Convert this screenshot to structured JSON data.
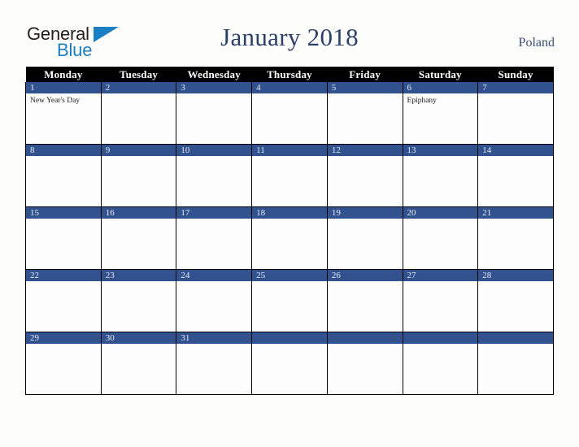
{
  "brand": {
    "name_part1": "General",
    "name_part2": "Blue",
    "triangle_icon": "triangle-icon",
    "accent_blue": "#1b7fc4"
  },
  "header": {
    "title": "January 2018",
    "region": "Poland",
    "title_color": "#2b3f69"
  },
  "calendar": {
    "month": "January",
    "year": "2018",
    "country": "Poland",
    "weekday_headers": [
      "Monday",
      "Tuesday",
      "Wednesday",
      "Thursday",
      "Friday",
      "Saturday",
      "Sunday"
    ],
    "header_bg": "#000000",
    "daybar_bg": "#31528f",
    "cell_bg": "#fdfdfd",
    "weeks": [
      {
        "days": [
          {
            "num": "1",
            "event": "New Year's Day"
          },
          {
            "num": "2",
            "event": ""
          },
          {
            "num": "3",
            "event": ""
          },
          {
            "num": "4",
            "event": ""
          },
          {
            "num": "5",
            "event": ""
          },
          {
            "num": "6",
            "event": "Epiphany"
          },
          {
            "num": "7",
            "event": ""
          }
        ]
      },
      {
        "days": [
          {
            "num": "8",
            "event": ""
          },
          {
            "num": "9",
            "event": ""
          },
          {
            "num": "10",
            "event": ""
          },
          {
            "num": "11",
            "event": ""
          },
          {
            "num": "12",
            "event": ""
          },
          {
            "num": "13",
            "event": ""
          },
          {
            "num": "14",
            "event": ""
          }
        ]
      },
      {
        "days": [
          {
            "num": "15",
            "event": ""
          },
          {
            "num": "16",
            "event": ""
          },
          {
            "num": "17",
            "event": ""
          },
          {
            "num": "18",
            "event": ""
          },
          {
            "num": "19",
            "event": ""
          },
          {
            "num": "20",
            "event": ""
          },
          {
            "num": "21",
            "event": ""
          }
        ]
      },
      {
        "days": [
          {
            "num": "22",
            "event": ""
          },
          {
            "num": "23",
            "event": ""
          },
          {
            "num": "24",
            "event": ""
          },
          {
            "num": "25",
            "event": ""
          },
          {
            "num": "26",
            "event": ""
          },
          {
            "num": "27",
            "event": ""
          },
          {
            "num": "28",
            "event": ""
          }
        ]
      },
      {
        "days": [
          {
            "num": "29",
            "event": ""
          },
          {
            "num": "30",
            "event": ""
          },
          {
            "num": "31",
            "event": ""
          },
          {
            "num": "",
            "event": ""
          },
          {
            "num": "",
            "event": ""
          },
          {
            "num": "",
            "event": ""
          },
          {
            "num": "",
            "event": ""
          }
        ]
      }
    ]
  }
}
